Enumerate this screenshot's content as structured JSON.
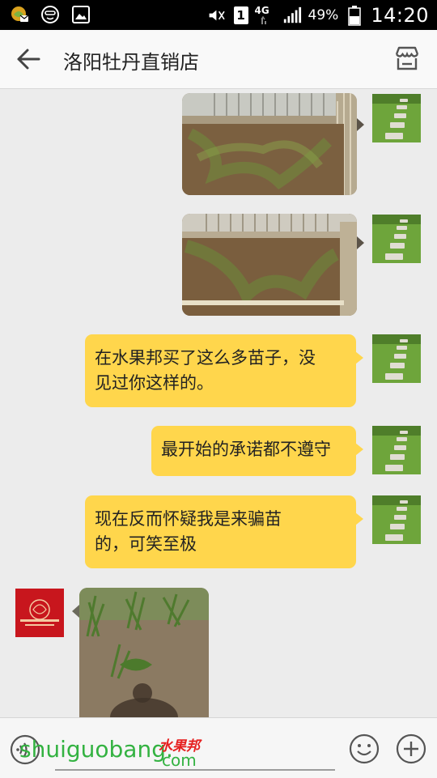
{
  "status_bar": {
    "battery": "49%",
    "time": "14:20",
    "network": "4G",
    "sim": "1"
  },
  "header": {
    "title": "洛阳牡丹直销店"
  },
  "messages": [
    {
      "side": "right",
      "type": "image"
    },
    {
      "side": "right",
      "type": "image"
    },
    {
      "side": "right",
      "type": "text",
      "text": "在水果邦买了这么多苗子，没\n见过你这样的。"
    },
    {
      "side": "right",
      "type": "text",
      "text": "最开始的承诺都不遵守"
    },
    {
      "side": "right",
      "type": "text",
      "text": "现在反而怀疑我是来骗苗\n的，可笑至极"
    },
    {
      "side": "left",
      "type": "image"
    }
  ],
  "watermark": {
    "domain": "shuiguobang.",
    "brand_cn": "水果邦",
    "tld": "com"
  },
  "colors": {
    "bubble": "#ffd64c",
    "background": "#ececec",
    "watermark_green": "#33b241",
    "store_red": "#c8161d"
  }
}
